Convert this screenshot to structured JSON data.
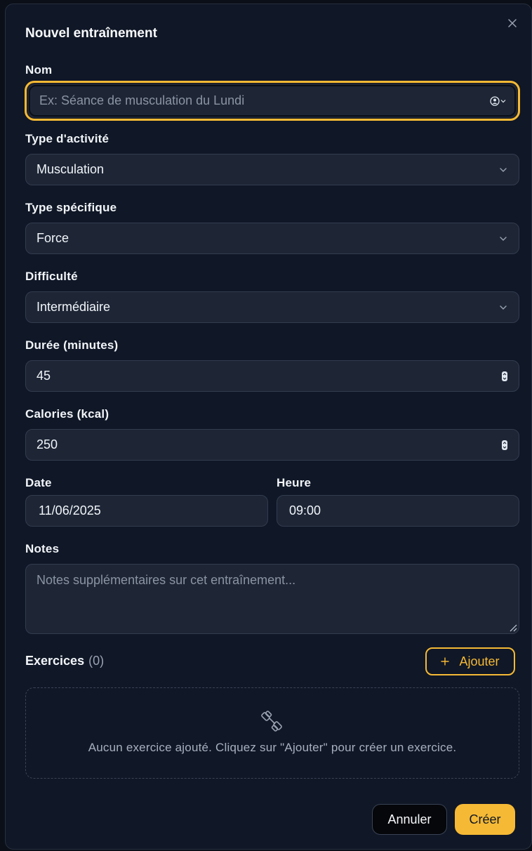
{
  "dialog": {
    "title": "Nouvel entraînement",
    "close_icon": "close-icon"
  },
  "fields": {
    "name": {
      "label": "Nom",
      "placeholder": "Ex: Séance de musculation du Lundi",
      "value": ""
    },
    "activity_type": {
      "label": "Type d'activité",
      "value": "Musculation"
    },
    "specific_type": {
      "label": "Type spécifique",
      "value": "Force"
    },
    "difficulty": {
      "label": "Difficulté",
      "value": "Intermédiaire"
    },
    "duration": {
      "label": "Durée (minutes)",
      "value": "45"
    },
    "calories": {
      "label": "Calories (kcal)",
      "value": "250"
    },
    "date": {
      "label": "Date",
      "value": "11/06/2025"
    },
    "time": {
      "label": "Heure",
      "value": "09:00"
    },
    "notes": {
      "label": "Notes",
      "placeholder": "Notes supplémentaires sur cet entraînement..."
    }
  },
  "exercises": {
    "label": "Exercices",
    "count": "(0)",
    "add_label": "Ajouter",
    "empty_text": "Aucun exercice ajouté. Cliquez sur \"Ajouter\" pour créer un exercice."
  },
  "actions": {
    "cancel_label": "Annuler",
    "create_label": "Créer"
  },
  "colors": {
    "accent": "#f5b935",
    "background": "#101726",
    "field": "#1e2636"
  }
}
